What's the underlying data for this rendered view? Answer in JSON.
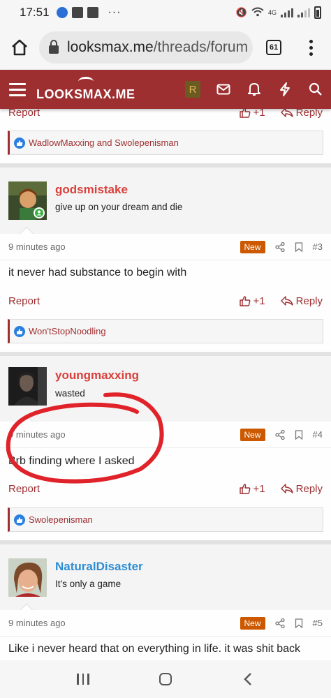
{
  "status_bar": {
    "time": "17:51",
    "network": "4G"
  },
  "browser": {
    "url_domain": "looksmax.me",
    "url_path": "/threads/forum",
    "tab_count": "61"
  },
  "site": {
    "logo_text": "LOOKSMAX.ME",
    "user_initial": "R",
    "brand_color": "#9e2f31"
  },
  "top_actions": {
    "report_label": "Report",
    "like_count": "+1",
    "reply_label": "Reply"
  },
  "top_reactions": "WadlowMaxxing and Swolepenisman",
  "posts": [
    {
      "username": "godsmistake",
      "user_title": "give up on your dream and die",
      "username_color": "#d9403b",
      "time": "9 minutes ago",
      "badge": "New",
      "number": "#3",
      "message": "it never had substance to begin with",
      "report_label": "Report",
      "like_count": "+1",
      "reply_label": "Reply",
      "reactions": "Won'tStopNoodling"
    },
    {
      "username": "youngmaxxing",
      "user_title": "wasted",
      "username_color": "#d9403b",
      "time": "9 minutes ago",
      "badge": "New",
      "number": "#4",
      "message": "Brb finding where I asked",
      "report_label": "Report",
      "like_count": "+1",
      "reply_label": "Reply",
      "reactions": "Swolepenisman"
    },
    {
      "username": "NaturalDisaster",
      "user_title": "It's only a game",
      "username_color": "#2d8dd4",
      "time": "9 minutes ago",
      "badge": "New",
      "number": "#5",
      "message": "Like i never heard that on everything in life. it was shit back"
    }
  ]
}
